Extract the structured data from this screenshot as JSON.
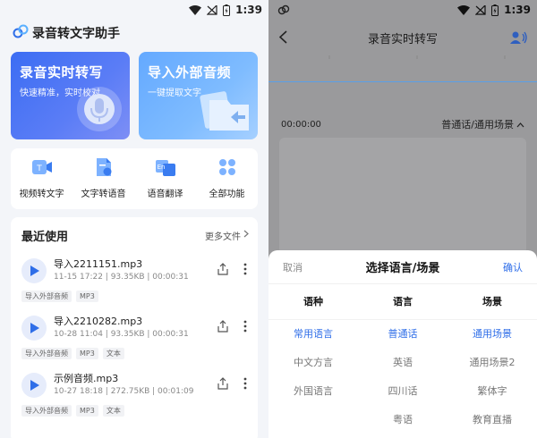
{
  "left_screen": {
    "status_time": "1:39",
    "app_title": "录音转文字助手",
    "card_record": {
      "title": "录音实时转写",
      "subtitle": "快速精准，实时校对"
    },
    "card_import": {
      "title": "导入外部音频",
      "subtitle": "一键提取文字"
    },
    "tools": [
      {
        "label": "视频转文字",
        "icon": "video-to-text-icon"
      },
      {
        "label": "文字转语音",
        "icon": "text-to-speech-icon"
      },
      {
        "label": "语音翻译",
        "icon": "voice-translate-icon"
      },
      {
        "label": "全部功能",
        "icon": "all-functions-icon"
      }
    ],
    "recent": {
      "title": "最近使用",
      "more_label": "更多文件",
      "files": [
        {
          "name": "导入2211151.mp3",
          "meta": "11-15 17:22 | 93.35KB | 00:00:31",
          "tags": [
            "导入外部音频",
            "MP3"
          ]
        },
        {
          "name": "导入2210282.mp3",
          "meta": "10-28 11:04 | 93.35KB | 00:00:31",
          "tags": [
            "导入外部音频",
            "MP3",
            "文本"
          ]
        },
        {
          "name": "示例音频.mp3",
          "meta": "10-27 18:18 | 272.75KB | 00:01:09",
          "tags": [
            "导入外部音频",
            "MP3",
            "文本"
          ]
        }
      ]
    }
  },
  "right_screen": {
    "status_time": "1:39",
    "title": "录音实时转写",
    "elapsed": "00:00:00",
    "language_scene": "普通话/通用场景",
    "sheet": {
      "cancel_label": "取消",
      "title": "选择语言/场景",
      "confirm_label": "确认",
      "columns": [
        {
          "header": "语种",
          "options": [
            "常用语言",
            "中文方言",
            "外国语言"
          ]
        },
        {
          "header": "语言",
          "options": [
            "普通话",
            "英语",
            "四川话",
            "粤语"
          ]
        },
        {
          "header": "场景",
          "options": [
            "通用场景",
            "通用场景2",
            "繁体字",
            "教育直播"
          ]
        }
      ]
    }
  },
  "colors": {
    "accent": "#2f6ee8",
    "card_record": "#3c6df3",
    "card_import": "#64a9ff",
    "overlay": "#9a9a9c"
  }
}
